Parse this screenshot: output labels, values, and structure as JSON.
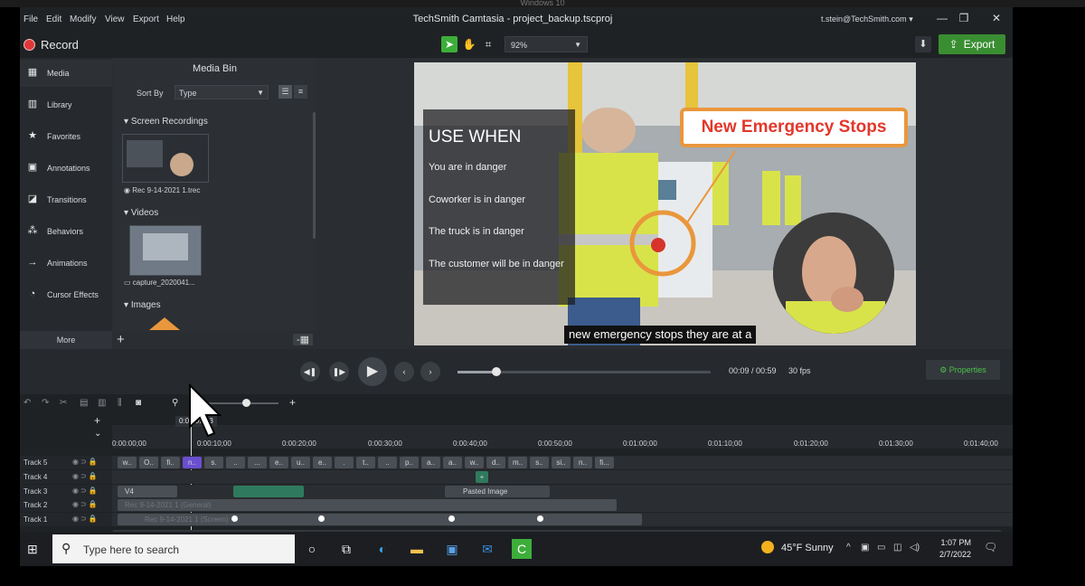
{
  "outer_title": "Windows 10",
  "menu": [
    "File",
    "Edit",
    "Modify",
    "View",
    "Export",
    "Help"
  ],
  "app_title": "TechSmith Camtasia - project_backup.tscproj",
  "account": "t.stein@TechSmith.com",
  "toolbar": {
    "record_label": "Record",
    "zoom_value": "92%",
    "export_label": "Export"
  },
  "sidebar": {
    "items": [
      {
        "label": "Media",
        "icon": "film-icon"
      },
      {
        "label": "Library",
        "icon": "library-icon"
      },
      {
        "label": "Favorites",
        "icon": "star-icon"
      },
      {
        "label": "Annotations",
        "icon": "annotation-icon"
      },
      {
        "label": "Transitions",
        "icon": "transition-icon"
      },
      {
        "label": "Behaviors",
        "icon": "behavior-icon"
      },
      {
        "label": "Animations",
        "icon": "animation-icon"
      },
      {
        "label": "Cursor Effects",
        "icon": "cursor-icon"
      }
    ],
    "more_label": "More"
  },
  "media_bin": {
    "title": "Media Bin",
    "sort_by_label": "Sort By",
    "sort_value": "Type",
    "sections": [
      {
        "title": "Screen Recordings",
        "item": "Rec 9-14-2021 1.trec"
      },
      {
        "title": "Videos",
        "item": "capture_2020041..."
      },
      {
        "title": "Images",
        "item": ""
      }
    ]
  },
  "video": {
    "use_when_title": "USE WHEN",
    "use_when_items": [
      "You are in danger",
      "Coworker is in danger",
      "The truck is in danger",
      "The customer will be in danger"
    ],
    "callout": "New Emergency Stops",
    "caption": "new emergency stops they are at a"
  },
  "playback": {
    "time": "00:09 / 00:59",
    "fps": "30 fps",
    "properties_label": "Properties",
    "progress_fraction": 0.153
  },
  "timeline": {
    "playhead_time": "0:00:09;03",
    "ruler_ticks": [
      "0:00:00;00",
      "0:00:10;00",
      "0:00:20;00",
      "0:00:30;00",
      "0:00:40;00",
      "0:00:50;00",
      "0:01:00;00",
      "0:01:10;00",
      "0:01:20;00",
      "0:01:30;00",
      "0:01:40;00"
    ],
    "tracks": [
      "Track 5",
      "Track 4",
      "Track 3",
      "Track 2",
      "Track 1"
    ],
    "track5_clips": [
      "w..",
      "O..",
      "fi..",
      "n..",
      "s.",
      "..",
      "...",
      "e..",
      "u..",
      "e..",
      ".",
      "t..",
      "..",
      "p..",
      "a..",
      "a..",
      "w..",
      "d..",
      "m..",
      "s..",
      "si..",
      "n..",
      "fi..."
    ],
    "track3_clip_label": "V4",
    "track3_image_label": "Pasted Image",
    "track2_clip_label": "Rec 9-14-2021 1 (General)",
    "track1_clip_label": "Rec 9-14-2021 1 (Screen)"
  },
  "taskbar": {
    "search_placeholder": "Type here to search",
    "weather": "45°F  Sunny",
    "time": "1:07 PM",
    "date": "2/7/2022"
  }
}
